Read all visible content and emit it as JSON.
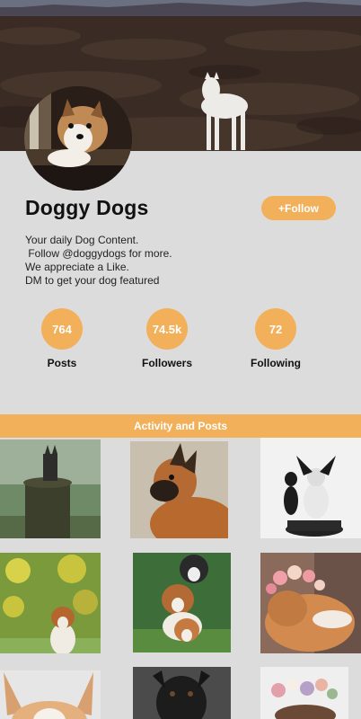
{
  "profile": {
    "name": "Doggy Dogs",
    "follow_label": "+Follow",
    "bio": "Your daily Dog Content.\n Follow @doggydogs for more.\nWe appreciate a Like.\nDM to get your dog featured"
  },
  "stats": [
    {
      "value": "764",
      "label": "Posts"
    },
    {
      "value": "74.5k",
      "label": "Followers"
    },
    {
      "value": "72",
      "label": "Following"
    }
  ],
  "section": {
    "title": "Activity and Posts"
  },
  "colors": {
    "accent": "#f2b05a",
    "background": "#dcdcdc"
  },
  "posts": [
    {
      "icon": "dog-on-stump-photo"
    },
    {
      "icon": "shepherd-dog-photo"
    },
    {
      "icon": "papillon-dogs-photo"
    },
    {
      "icon": "sheltie-puppy-photo"
    },
    {
      "icon": "three-dogs-photo"
    },
    {
      "icon": "collie-flower-crown-photo"
    },
    {
      "icon": "corgi-ears-photo"
    },
    {
      "icon": "black-dog-photo"
    },
    {
      "icon": "dog-flowers-photo"
    }
  ]
}
